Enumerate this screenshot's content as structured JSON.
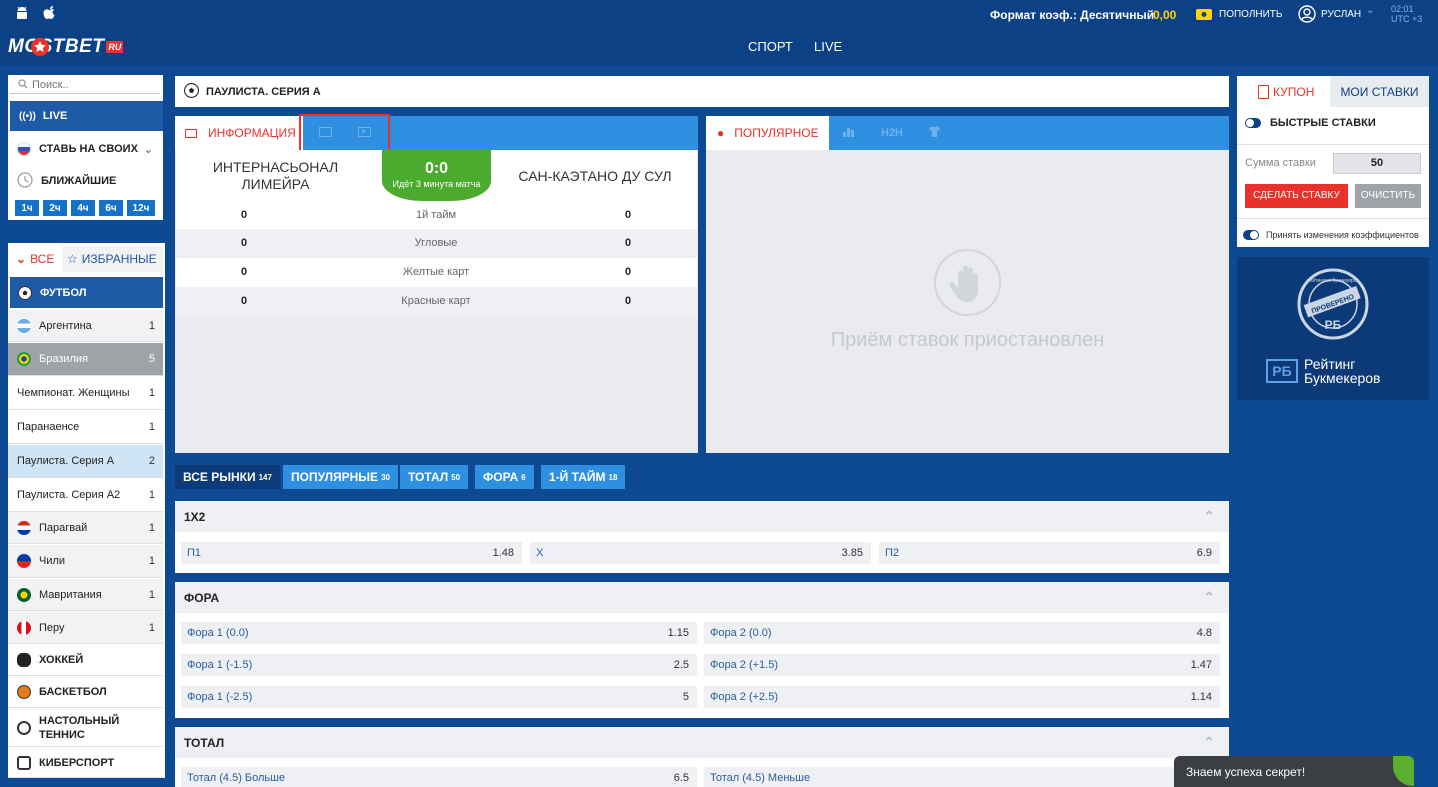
{
  "topbar": {
    "odds_format_label": "Формат коэф.: Десятичный",
    "balance": "0,00",
    "deposit_label": "ПОПОЛНИТЬ",
    "username": "РУСЛАН",
    "time": "02:01",
    "timezone": "UTC +3"
  },
  "brand": {
    "logo": "MOSTBET",
    "logo_suffix": "RU"
  },
  "nav": {
    "items": [
      "СПОРТ",
      "LIVE"
    ]
  },
  "sidebar": {
    "search_placeholder": "Поиск..",
    "live_label": "LIVE",
    "bet_own_label": "СТАВЬ НА СВОИХ",
    "upcoming_label": "БЛИЖАЙШИЕ",
    "hours": [
      "1ч",
      "2ч",
      "4ч",
      "6ч",
      "12ч"
    ],
    "tab_all": "ВСЕ",
    "tab_favorites": "ИЗБРАННЫЕ",
    "sport_football": "ФУТБОЛ",
    "leagues": [
      {
        "name": "Аргентина",
        "count": "1"
      },
      {
        "name": "Бразилия",
        "count": "5"
      },
      {
        "name": "Чемпионат. Женщины",
        "count": "1"
      },
      {
        "name": "Паранаенсе",
        "count": "1"
      },
      {
        "name": "Паулиста. Серия А",
        "count": "2"
      },
      {
        "name": "Паулиста. Серия А2",
        "count": "1"
      },
      {
        "name": "Парагвай",
        "count": "1"
      },
      {
        "name": "Чили",
        "count": "1"
      },
      {
        "name": "Мавритания",
        "count": "1"
      },
      {
        "name": "Перу",
        "count": "1"
      }
    ],
    "sports": [
      "ХОККЕЙ",
      "БАСКЕТБОЛ",
      "НАСТОЛЬНЫЙ ТЕННИС",
      "КИБЕРСПОРТ"
    ]
  },
  "match": {
    "league_title": "ПАУЛИСТА. СЕРИЯ А",
    "info_tab": "ИНФОРМАЦИЯ",
    "team_home": "ИНТЕРНАСЬОНАЛ ЛИМЕЙРА",
    "team_away": "САН-КАЭТАНО ДУ СУЛ",
    "score": "0:0",
    "status": "Идёт 3 минута матча",
    "stats": [
      {
        "label": "1й тайм",
        "home": "0",
        "away": "0"
      },
      {
        "label": "Угловые",
        "home": "0",
        "away": "0"
      },
      {
        "label": "Желтые карт",
        "home": "0",
        "away": "0"
      },
      {
        "label": "Красные карт",
        "home": "0",
        "away": "0"
      }
    ],
    "popular_tab": "ПОПУЛЯРНОЕ",
    "h2h_tab": "H2H",
    "suspended_text": "Приём ставок приостановлен"
  },
  "market_tabs": [
    {
      "label": "ВСЕ РЫНКИ",
      "count": "147"
    },
    {
      "label": "ПОПУЛЯРНЫЕ",
      "count": "30"
    },
    {
      "label": "ТОТАЛ",
      "count": "50"
    },
    {
      "label": "ФОРА",
      "count": "6"
    },
    {
      "label": "1-Й ТАЙМ",
      "count": "18"
    }
  ],
  "markets": {
    "x12": {
      "title": "1X2",
      "odds": [
        {
          "name": "П1",
          "value": "1.48"
        },
        {
          "name": "Х",
          "value": "3.85"
        },
        {
          "name": "П2",
          "value": "6.9"
        }
      ]
    },
    "handicap": {
      "title": "ФОРА",
      "odds": [
        {
          "name": "Фора 1 (0.0)",
          "value": "1.15"
        },
        {
          "name": "Фора 2 (0.0)",
          "value": "4.8"
        },
        {
          "name": "Фора 1 (-1.5)",
          "value": "2.5"
        },
        {
          "name": "Фора 2 (+1.5)",
          "value": "1.47"
        },
        {
          "name": "Фора 1 (-2.5)",
          "value": "5"
        },
        {
          "name": "Фора 2 (+2.5)",
          "value": "1.14"
        }
      ]
    },
    "total": {
      "title": "ТОТАЛ",
      "odds": [
        {
          "name": "Тотал (4.5) Больше",
          "value": "6.5"
        },
        {
          "name": "Тотал (4.5) Меньше",
          "value": ""
        }
      ]
    }
  },
  "coupon": {
    "tab_coupon": "КУПОН",
    "tab_my_bets": "МОИ СТАВКИ",
    "quick_bets": "БЫСТРЫЕ СТАВКИ",
    "stake_label": "Сумма ставки",
    "stake_value": "50",
    "place_bet": "СДЕЛАТЬ СТАВКУ",
    "clear": "ОЧИСТИТЬ",
    "accept_changes": "Принять изменения коэффициентов"
  },
  "banner": {
    "line1": "Рейтинг",
    "line2": "Букмекеров",
    "stamp_text": "ПРОВЕРЕНО",
    "stamp_ring": "рейтингом букмекеров",
    "badge": "РБ"
  },
  "chat": {
    "text": "Знаем успеха секрет!"
  },
  "colors": {
    "accent": "#e9322c",
    "primary": "#0d4186",
    "tab_blue": "#2f8fe0",
    "live_green": "#4aab2e",
    "balance": "#ffd700"
  }
}
